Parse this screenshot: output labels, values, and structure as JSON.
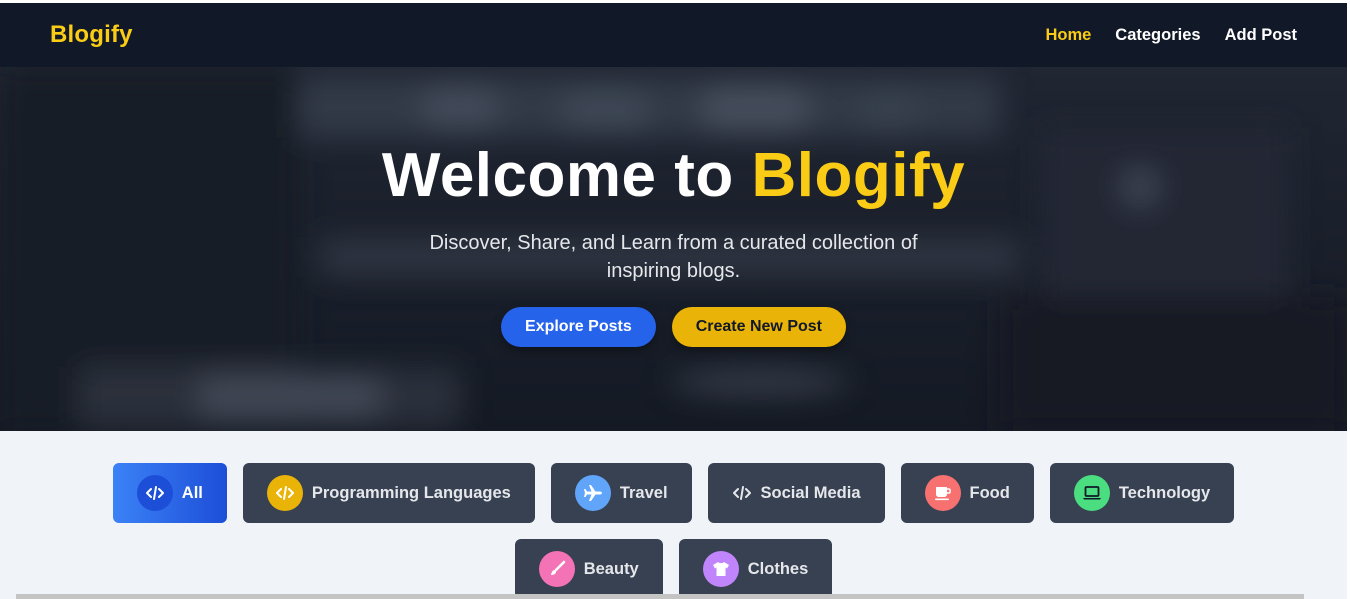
{
  "navbar": {
    "brand": "Blogify",
    "links": [
      {
        "label": "Home",
        "active": true
      },
      {
        "label": "Categories",
        "active": false
      },
      {
        "label": "Add Post",
        "active": false
      }
    ]
  },
  "hero": {
    "title_prefix": "Welcome to ",
    "title_accent": "Blogify",
    "subtitle": "Discover, Share, and Learn from a curated collection of inspiring blogs.",
    "buttons": {
      "explore": "Explore Posts",
      "create": "Create New Post"
    }
  },
  "categories": [
    {
      "label": "All",
      "icon": "code-icon",
      "icon_bg": "#1d4ed8",
      "active": true
    },
    {
      "label": "Programming Languages",
      "icon": "code-icon",
      "icon_bg": "#eab308",
      "active": false
    },
    {
      "label": "Travel",
      "icon": "airplane-icon",
      "icon_bg": "#60a5fa",
      "active": false
    },
    {
      "label": "Social Media",
      "icon": "code-icon",
      "icon_bg": "",
      "active": false
    },
    {
      "label": "Food",
      "icon": "coffee-cup-icon",
      "icon_bg": "#f87171",
      "active": false
    },
    {
      "label": "Technology",
      "icon": "laptop-icon",
      "icon_bg": "#4ade80",
      "active": false
    },
    {
      "label": "Beauty",
      "icon": "brush-icon",
      "icon_bg": "#f472b6",
      "active": false
    },
    {
      "label": "Clothes",
      "icon": "shirt-icon",
      "icon_bg": "#c084fc",
      "active": false
    }
  ],
  "colors": {
    "accent_yellow": "#facc15",
    "nav_bg": "#111827",
    "primary_blue": "#2563eb",
    "chip_bg": "#374151"
  }
}
